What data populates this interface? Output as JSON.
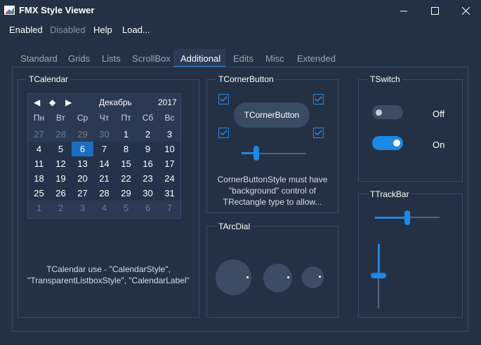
{
  "window": {
    "title": "FMX Style Viewer",
    "minimize_icon": "minimize-icon",
    "maximize_icon": "maximize-icon",
    "close_icon": "close-icon"
  },
  "menu": [
    "Enabled",
    "Disabled",
    "Help",
    "Load..."
  ],
  "tabs": [
    "Standard",
    "Grids",
    "Lists",
    "ScrollBox",
    "Additional",
    "Edits",
    "Misc",
    "Extended"
  ],
  "active_tab": "Additional",
  "calendar": {
    "group_title": "TCalendar",
    "month": "Декабрь",
    "year": "2017",
    "nav": [
      "◀",
      "◆",
      "▶"
    ],
    "weekdays": [
      "Пн",
      "Вт",
      "Ср",
      "Чт",
      "Пт",
      "Сб",
      "Вс"
    ],
    "weeks": [
      [
        "27",
        "28",
        "29",
        "30",
        "1",
        "2",
        "3"
      ],
      [
        "4",
        "5",
        "6",
        "7",
        "8",
        "9",
        "10"
      ],
      [
        "11",
        "12",
        "13",
        "14",
        "15",
        "16",
        "17"
      ],
      [
        "18",
        "19",
        "20",
        "21",
        "22",
        "23",
        "24"
      ],
      [
        "25",
        "26",
        "27",
        "28",
        "29",
        "30",
        "31"
      ],
      [
        "1",
        "2",
        "3",
        "4",
        "5",
        "6",
        "7"
      ]
    ],
    "selected": "6",
    "description_line1": "TCalendar use - \"CalendarStyle\",",
    "description_line2": "\"TransparentListboxStyle\", \"CalendarLabel\""
  },
  "corner_button": {
    "group_title": "TCornerButton",
    "button_label": "TCornerButton",
    "checks": [
      true,
      true,
      true,
      true
    ],
    "slider_value": 0.22,
    "description_line1": "CornerButtonStyle must have",
    "description_line2": "\"background\" control of",
    "description_line3": "TRectangle type to allow..."
  },
  "switch": {
    "group_title": "TSwitch",
    "off_label": "Off",
    "on_label": "On",
    "accent": "#1e88e5"
  },
  "trackbar": {
    "group_title": "TTrackBar",
    "horizontal_value": 0.49,
    "vertical_value": 0.49
  },
  "arcdial": {
    "group_title": "TArcDial"
  }
}
